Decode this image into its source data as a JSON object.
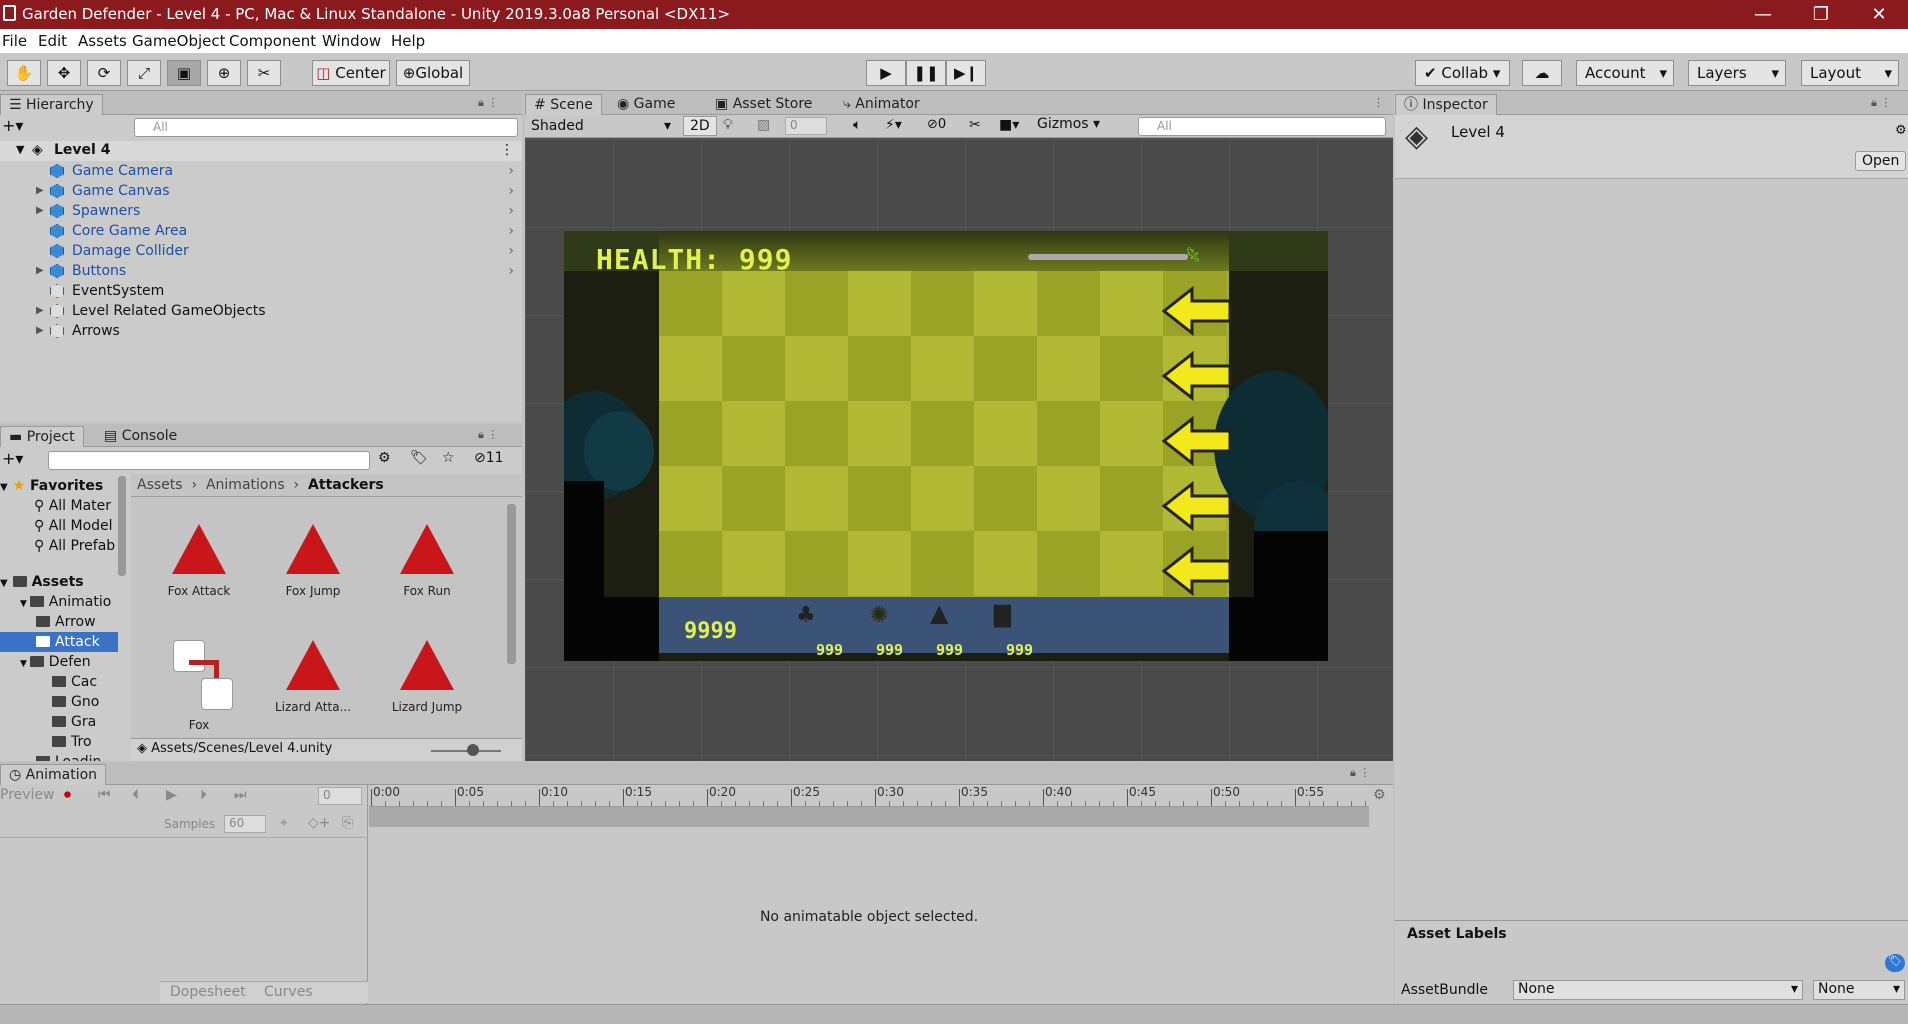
{
  "title": "Garden Defender - Level 4 - PC, Mac & Linux Standalone - Unity 2019.3.0a8 Personal <DX11>",
  "window_buttons": [
    "—",
    "❐",
    "✕"
  ],
  "menu": [
    "File",
    "Edit",
    "Assets",
    "GameObject",
    "Component",
    "Window",
    "Help"
  ],
  "toolbar": {
    "pivot": "Center",
    "space": "Global",
    "collab": "Collab",
    "account": "Account",
    "layers": "Layers",
    "layout": "Layout"
  },
  "hierarchy": {
    "tab": "Hierarchy",
    "search_placeholder": "All",
    "scene": "Level 4",
    "items": [
      {
        "label": "Game Camera",
        "icon": "blue",
        "expandable": false
      },
      {
        "label": "Game Canvas",
        "icon": "blue",
        "expandable": true
      },
      {
        "label": "Spawners",
        "icon": "blue",
        "expandable": true
      },
      {
        "label": "Core Game Area",
        "icon": "blue",
        "expandable": false
      },
      {
        "label": "Damage Collider",
        "icon": "blue",
        "expandable": false
      },
      {
        "label": "Buttons",
        "icon": "blue",
        "expandable": true
      },
      {
        "label": "EventSystem",
        "icon": "gray",
        "expandable": false
      },
      {
        "label": "Level Related GameObjects",
        "icon": "gray",
        "expandable": true
      },
      {
        "label": "Arrows",
        "icon": "gray",
        "expandable": true
      }
    ]
  },
  "project": {
    "tab_project": "Project",
    "tab_console": "Console",
    "hidden_count": "11",
    "favorites_label": "Favorites",
    "favorites": [
      "All Mater",
      "All Model",
      "All Prefab"
    ],
    "assets_label": "Assets",
    "tree": [
      {
        "label": "Animatio",
        "indent": 1
      },
      {
        "label": "Arrow",
        "indent": 2
      },
      {
        "label": "Attack",
        "indent": 2
      },
      {
        "label": "Defen",
        "indent": 1
      },
      {
        "label": "Cac",
        "indent": 3
      },
      {
        "label": "Gno",
        "indent": 3
      },
      {
        "label": "Gra",
        "indent": 3
      },
      {
        "label": "Tro",
        "indent": 3
      },
      {
        "label": "Loadin",
        "indent": 2
      }
    ],
    "breadcrumb": [
      "Assets",
      "Animations",
      "Attackers"
    ],
    "assets": [
      "Fox Attack",
      "Fox Jump",
      "Fox Run",
      "Fox",
      "Lizard Atta...",
      "Lizard Jump"
    ],
    "status_path": "Assets/Scenes/Level 4.unity"
  },
  "scene": {
    "tabs": [
      "Scene",
      "Game",
      "Asset Store",
      "Animator"
    ],
    "shading": "Shaded",
    "mode_2d": "2D",
    "fx_value": "0",
    "hidden_value": "0",
    "gizmos": "Gizmos",
    "search_placeholder": "All"
  },
  "game": {
    "health_label": "HEALTH: 999",
    "stars": "9999",
    "defender_costs": [
      "999",
      "999",
      "999",
      "999"
    ]
  },
  "inspector": {
    "tab": "Inspector",
    "object": "Level 4",
    "open_button": "Open",
    "asset_labels": "Asset Labels",
    "assetbundle_label": "AssetBundle",
    "assetbundle_value": "None",
    "variant_value": "None"
  },
  "animation": {
    "tab": "Animation",
    "preview": "Preview",
    "frame": "0",
    "samples_label": "Samples",
    "samples_value": "60",
    "ticks": [
      "0:00",
      "0:05",
      "0:10",
      "0:15",
      "0:20",
      "0:25",
      "0:30",
      "0:35",
      "0:40",
      "0:45",
      "0:50",
      "0:55"
    ],
    "empty_message": "No animatable object selected.",
    "dopesheet": "Dopesheet",
    "curves": "Curves"
  }
}
